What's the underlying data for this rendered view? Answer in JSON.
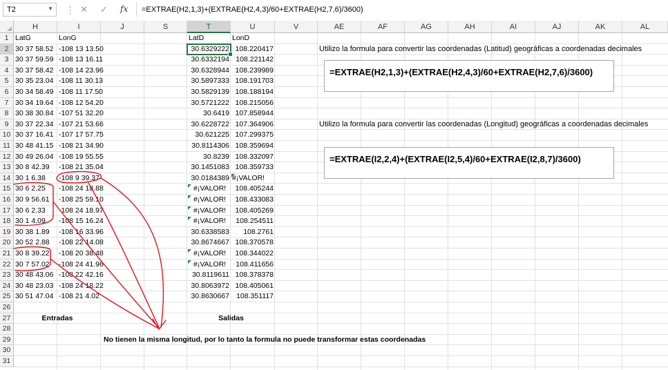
{
  "formula_bar": {
    "name_box": "T2",
    "cancel_icon": "✕",
    "enter_icon": "✓",
    "fx_label": "fx",
    "formula": "=EXTRAE(H2,1,3)+(EXTRAE(H2,4,3)/60+EXTRAE(H2,7,6)/3600)"
  },
  "columns": [
    "H",
    "I",
    "J",
    "S",
    "T",
    "U",
    "V",
    "AE",
    "AF",
    "AG",
    "AH",
    "AI",
    "AJ",
    "AK",
    "AL"
  ],
  "selected_column": "T",
  "selected_row": "2",
  "rows": [
    "1",
    "2",
    "3",
    "4",
    "5",
    "6",
    "7",
    "8",
    "9",
    "10",
    "11",
    "12",
    "13",
    "14",
    "15",
    "16",
    "17",
    "18",
    "19",
    "20",
    "21",
    "22",
    "23",
    "24",
    "25",
    "26",
    "27",
    "28",
    "29",
    "30",
    "31"
  ],
  "headers": {
    "latg": "LatG",
    "long": "LonG",
    "latd": "LatD",
    "lond": "LonD"
  },
  "table": [
    {
      "latg": "30 37 58.52",
      "long": "-108 13 13.50",
      "latd": "30.6329222",
      "lond": "108.220417"
    },
    {
      "latg": "30 37 59.59",
      "long": "-108 13 16.11",
      "latd": "30.6332194",
      "lond": "108.221142"
    },
    {
      "latg": "30 37 58.42",
      "long": "-108 14 23.96",
      "latd": "30.6328944",
      "lond": "108.239989"
    },
    {
      "latg": "30 35 23.04",
      "long": "-108 11 30.13",
      "latd": "30.5897333",
      "lond": "108.191703"
    },
    {
      "latg": "30 34 58.49",
      "long": "-108 11 17.50",
      "latd": "30.5829139",
      "lond": "108.188194"
    },
    {
      "latg": "30 34 19.64",
      "long": "-108 12 54.20",
      "latd": "30.5721222",
      "lond": "108.215056"
    },
    {
      "latg": "30 38 30.84",
      "long": "-107 51 32.20",
      "latd": "30.6419",
      "lond": "107.858944"
    },
    {
      "latg": "30 37 22.34",
      "long": "-107 21 53.66",
      "latd": "30.6228722",
      "lond": "107.364906"
    },
    {
      "latg": "30 37 16.41",
      "long": "-107 17 57.75",
      "latd": "30.621225",
      "lond": "107.299375"
    },
    {
      "latg": "30 48 41.15",
      "long": "-108 21 34.90",
      "latd": "30.8114306",
      "lond": "108.359694"
    },
    {
      "latg": "30 49 26.04",
      "long": "-108 19 55.55",
      "latd": "30.8239",
      "lond": "108.332097"
    },
    {
      "latg": "30 8 42.39",
      "long": "-108 21 35.04",
      "latd": "30.1451083",
      "lond": "108.359733"
    },
    {
      "latg": "30 1 6.38",
      "long": "-108 9 39.37",
      "latd": "30.0184389",
      "lond": "#¡VALOR!"
    },
    {
      "latg": "30 6 2.25",
      "long": "-108 24 18.88",
      "latd": "#¡VALOR!",
      "lond": "108.405244"
    },
    {
      "latg": "30 9 56.61",
      "long": "-108 25 59.10",
      "latd": "#¡VALOR!",
      "lond": "108.433083"
    },
    {
      "latg": "30 6 2.33",
      "long": "-108 24 18.97",
      "latd": "#¡VALOR!",
      "lond": "108.405269"
    },
    {
      "latg": "30 1 4.09",
      "long": "-108 15 16.24",
      "latd": "#¡VALOR!",
      "lond": "108.254511"
    },
    {
      "latg": "30 38 1.89",
      "long": "-108 16 33.96",
      "latd": "30.6338583",
      "lond": "108.2761"
    },
    {
      "latg": "30 52 2.88",
      "long": "-108 22 14.08",
      "latd": "30.8674667",
      "lond": "108.370578"
    },
    {
      "latg": "30 8 39.22",
      "long": "-108 20 38.48",
      "latd": "#¡VALOR!",
      "lond": "108.344022"
    },
    {
      "latg": "30 7 57.02",
      "long": "-108 24 41.96",
      "latd": "#¡VALOR!",
      "lond": "108.411656"
    },
    {
      "latg": "30 48 43.06",
      "long": "-108 22 42.16",
      "latd": "30.8119611",
      "lond": "108.378378"
    },
    {
      "latg": "30 48 23.03",
      "long": "-108 24 18.22",
      "latd": "30.8063972",
      "lond": "108.405061"
    },
    {
      "latg": "30 51 47.04",
      "long": "-108 21 4.02",
      "latd": "30.8630667",
      "lond": "108.351117"
    }
  ],
  "labels": {
    "entradas": "Entradas",
    "salidas": "Salidas",
    "note_lat": "Utilizo la formula para convertir las coordenadas (Latitud) geográficas a coordenadas decimales",
    "formula_lat": "=EXTRAE(H2,1,3)+(EXTRAE(H2,4,3)/60+EXTRAE(H2,7,6)/3600)",
    "note_lon": "Utilizo la formula para convertir las coordenadas (Longitud) geográficas a coordenadas decimales",
    "formula_lon": "=EXTRAE(I2,2,4)+(EXTRAE(I2,5,4)/60+EXTRAE(I2,8,7)/3600)",
    "bottom_note": "No tienen la misma longitud, por lo tanto la formula no puede transformar estas coordenadas"
  },
  "colors": {
    "excel_green": "#217346",
    "annotation_red": "#e0141e",
    "grid": "#e1e1e1"
  }
}
